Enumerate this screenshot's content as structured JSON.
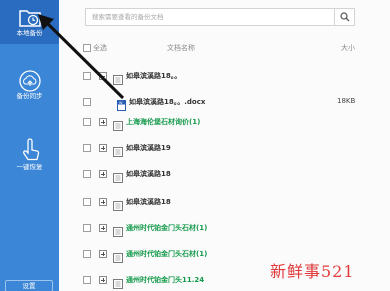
{
  "sidebar": {
    "items": [
      {
        "label": "本地备份",
        "icon": "folder-clock-icon",
        "active": true
      },
      {
        "label": "备份同步",
        "icon": "cloud-upload-icon",
        "active": false
      },
      {
        "label": "一键恢复",
        "icon": "hand-pointer-icon",
        "active": false
      }
    ],
    "bottom_label": "设置"
  },
  "search": {
    "placeholder": "搜索需要查看的备份文档",
    "icon": "search-icon"
  },
  "table": {
    "headers": {
      "select_all": "全选",
      "name": "文档名称",
      "size": "大小"
    },
    "rows": [
      {
        "name": "如皋滨溪路18。。",
        "size": "",
        "expanded": true,
        "green": false
      },
      {
        "name": "如皋滨溪路18。。.docx",
        "size": "18KB",
        "expanded": false,
        "green": false,
        "child": true
      },
      {
        "name": "上海海伦堡石材询价(1)",
        "size": "",
        "expanded": false,
        "green": true
      },
      {
        "name": "如皋滨溪路19",
        "size": "",
        "expanded": false,
        "green": false
      },
      {
        "name": "如皋滨溪路18",
        "size": "",
        "expanded": false,
        "green": false
      },
      {
        "name": "如皋滨溪路18",
        "size": "",
        "expanded": false,
        "green": false
      },
      {
        "name": "通州时代铂金门头石材(1)",
        "size": "",
        "expanded": false,
        "green": true
      },
      {
        "name": "通州时代铂金门头石材(1)",
        "size": "",
        "expanded": false,
        "green": true
      },
      {
        "name": "通州时代铂金门头11.24",
        "size": "",
        "expanded": false,
        "green": true
      }
    ]
  },
  "watermark": "新鲜事521",
  "colors": {
    "sidebar": "#3b86d6",
    "sidebar_active": "#2a6cbf",
    "green_text": "#159a4b",
    "watermark": "#e23a3a",
    "arrow": "#111111"
  }
}
